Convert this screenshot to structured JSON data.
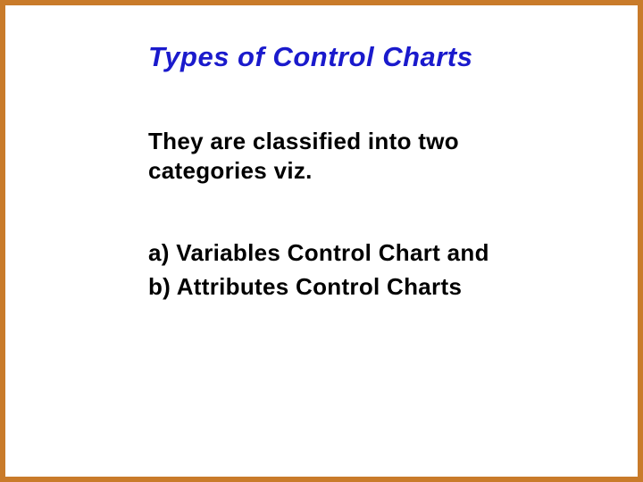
{
  "slide": {
    "title": "Types of Control Charts",
    "intro": "They are classified into two categories viz.",
    "items": [
      "a) Variables Control  Chart and",
      "b) Attributes Control Charts"
    ]
  }
}
